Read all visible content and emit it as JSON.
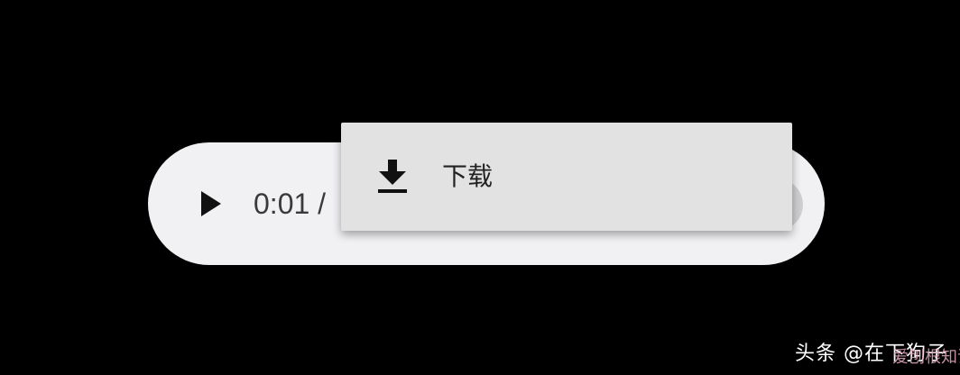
{
  "player": {
    "time_display": "0:01 /",
    "play_icon": "play-icon",
    "more_icon": "more-options-icon"
  },
  "context_menu": {
    "items": [
      {
        "label": "下载",
        "icon": "download-icon"
      }
    ]
  },
  "watermark": {
    "main": "头条 @在下狗子",
    "overlay": "爱刨根知识网"
  },
  "colors": {
    "background": "#000000",
    "player_bg": "#f1f1f3",
    "menu_bg": "#e3e2e2",
    "text": "#3a3a3a"
  }
}
